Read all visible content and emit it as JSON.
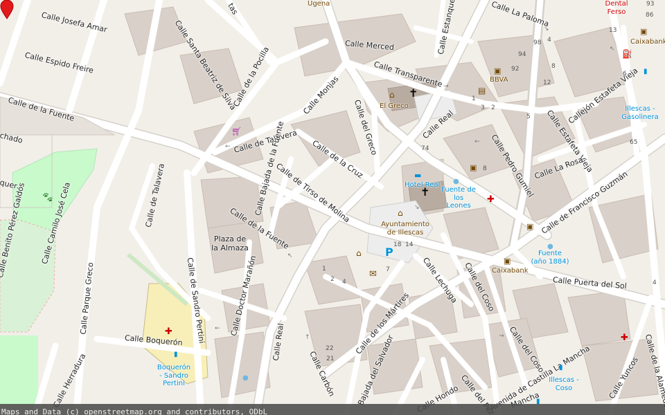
{
  "map": {
    "streets": {
      "josefa_amar": "Calle Josefa Amar",
      "espido_freire": "Calle Espido Freire",
      "de_la_fuente_w": "Calle de la Fuente",
      "de_la_fuente_c": "Calle de la Fuente",
      "santa_beatriz": "Calle Santa Beatriz de Silva",
      "de_la_pocilla": "Calle de la Pocilla",
      "monjas": "Calle Monjas",
      "del_greco": "Calle del Greco",
      "merced": "Calle Merced",
      "transparente": "Calle Transparente",
      "estanque": "Calle Estanque",
      "la_paloma": "Calle La Paloma",
      "de_talavera_n": "Calle de Talavera",
      "de_talavera_w": "Calle de Talavera",
      "bajada_fuente": "Calle Bajada de la Fuente",
      "de_la_cruz": "Calle de la Cruz",
      "tirso_de_molina": "Calle de Tirso de Molina",
      "calle_real_n": "Calle Real",
      "calle_real_s": "Calle Real",
      "pedro_gumiel": "Calle Pedro Gumiel",
      "estafeta_vieja": "Calle Estafeta Vieja",
      "callejon_estafeta": "Callejón Estafeta Vieja",
      "la_rosa": "Calle La Rosa",
      "francisco_guzman": "Calle de Francisco Guzmán",
      "camilo_jose_cela": "Calle Camilo José Cela",
      "benito_perez": "Calle Benito Pérez Galdós",
      "parque_greco": "Calle Parque Greco",
      "sandro_pertini": "Calle de Sandro Pertini",
      "doctor_maranon": "Calle Doctor Marañón",
      "boqueron": "Calle Boquerón",
      "herradura": "Calle Herradura",
      "carbon": "Calle Carbón",
      "de_los_martires": "Calle de los Mártires",
      "bajada_salvador": "Bajada del Salvador",
      "lechuga": "Calle Lechuga",
      "del_coso": "Calle del Coso",
      "del_coso_2": "Calle del Coso",
      "puerta_del_sol": "Calle Puerta del Sol",
      "hondo": "Calle Hondo",
      "del_pez": "Calle del Pez",
      "castilla_la_mancha": "Avenida de Castilla La Mancha",
      "mancha": "Mancha",
      "yuncos": "Calle Yuncos",
      "de_la_alameda": "Calle de la Alameda",
      "partial_chado": "chado",
      "partial_quer": "quer",
      "partial_tas": "tas"
    },
    "places": {
      "plaza_almaza": "Plaza de la Almaza",
      "ugena": "Ugena",
      "el_greco": "El Greco",
      "bbva": "BBVA",
      "caixabank_ne": "Caixabank",
      "caixabank_c": "Caixabank",
      "dental_ferso": "Dental Ferso",
      "hotel_real": "Hotel Real",
      "fuente_leones": "Fuente de los Leones",
      "ayuntamiento": "Ayuntamiento de Illescas",
      "fuente_1884": "Fuente (año 1884)",
      "illescas_gasolinera": "Illescas - Gasolinera",
      "boqueron_stop": "Boquerón - Sandro Pertini",
      "illescas_coso": "Illescas - Coso",
      "parking": "P"
    },
    "house_numbers": [
      "86",
      "93",
      "13",
      "98",
      "4",
      "94",
      "92",
      "8",
      "12",
      "6",
      "3",
      "1",
      "5",
      "2",
      "65",
      "74",
      "8",
      "18",
      "14",
      "7",
      "1",
      "2",
      "4",
      "22",
      "21",
      "4"
    ],
    "icons": {
      "marker": "location-pin",
      "church": "church-icon",
      "museum": "museum-icon",
      "bank": "bank-icon",
      "hotel": "hotel-icon",
      "pharmacy": "pharmacy-icon",
      "post": "post-office-icon",
      "bus": "bus-stop-icon",
      "fuel": "fuel-icon",
      "shop": "shop-icon",
      "dog_park": "dog-park-icon",
      "library": "library-icon"
    },
    "colors": {
      "background": "#f2efe9",
      "building": "#d9d0c9",
      "road": "#ffffff",
      "park": "#c8facc",
      "marker": "#e31a1c"
    }
  },
  "attribution": "Maps and Data (c) openstreetmap.org and contributors, ODbL"
}
